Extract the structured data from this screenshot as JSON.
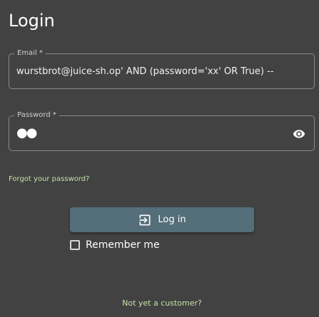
{
  "title": "Login",
  "email": {
    "label": "Email *",
    "value": "wurstbrot@juice-sh.op' AND (password='xx' OR True) --"
  },
  "password": {
    "label": "Password *",
    "masked_value": "●●",
    "toggle_icon": "eye-icon"
  },
  "forgot_password": "Forgot your password?",
  "login_button": {
    "label": "Log in",
    "icon": "login-icon"
  },
  "remember_me": {
    "label": "Remember me",
    "checked": false
  },
  "register_link": "Not yet a customer?",
  "colors": {
    "background": "#424242",
    "button": "#546e7a",
    "link": "#c5e1a5"
  }
}
